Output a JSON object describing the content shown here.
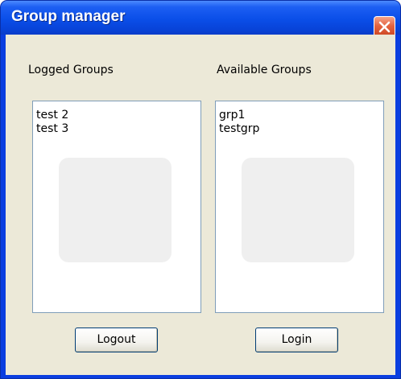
{
  "window": {
    "title": "Group manager"
  },
  "titlebar": {
    "close_icon": "close-icon"
  },
  "logged": {
    "label": "Logged Groups",
    "items": [
      "test 2",
      "test 3"
    ],
    "button_label": "Logout"
  },
  "available": {
    "label": "Available Groups",
    "items": [
      "grp1",
      "testgrp"
    ],
    "button_label": "Login"
  },
  "colors": {
    "titlebar": "#0a4ee8",
    "client_bg": "#ece9d8",
    "close_button": "#e4633f",
    "list_border": "#7f9db9"
  }
}
